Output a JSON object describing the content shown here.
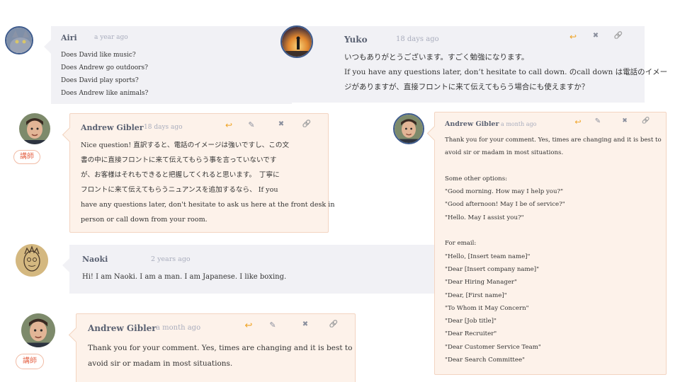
{
  "comments": {
    "airi": {
      "name": "Airi",
      "time": "a year ago",
      "lines": [
        "Does David like music?",
        "Does Andrew go outdoors?",
        "Does David play sports?",
        "Does Andrew like animals?"
      ]
    },
    "yuko": {
      "name": "Yuko",
      "time": "18 days ago",
      "lines": [
        "いつもありがとうございます。すごく勉強になります。",
        "If you have any questions later, don’t hesitate to call down. のcall down は電話のイメー",
        "ジがありますが、直接フロントに来て伝えてもらう場合にも使えますか？"
      ]
    },
    "andrew1": {
      "name": "Andrew Gibler",
      "time": "18 days ago",
      "badge": "講師",
      "lines": [
        "Nice question! 直訳すると、電話のイメージは強いですし、この文",
        "書の中に直接フロントに来て伝えてもらう事を言っていないです",
        "が、お客様はそれもできると把握してくれると思います。　丁寧に",
        "フロントに来て伝えてもらうニュアンスを追加するなら、 If you",
        "have any questions later, don't hesitate to ask us here at the front desk in",
        "person or call down from your room."
      ]
    },
    "andrew2": {
      "name": "Andrew Gibler",
      "time": "a month ago",
      "lines": [
        "Thank you for your comment. Yes, times are changing and it is best to",
        "avoid sir or madam in most situations.",
        "",
        "Some other options:",
        "\"Good morning. How may I help you?\"",
        "\"Good afternoon! May I be of service?\"",
        "\"Hello. May I assist you?\"",
        "",
        "For email:",
        "\"Hello, [Insert team name]\"",
        "\"Dear [Insert company name]\"",
        "\"Dear Hiring Manager\"",
        "\"Dear, [First name]\"",
        "\"To Whom it May Concern\"",
        "\"Dear [Job title]\"",
        "\"Dear Recruiter\"",
        "\"Dear Customer Service Team\"",
        "\"Dear Search Committee\""
      ]
    },
    "naoki": {
      "name": "Naoki",
      "time": "2 years ago",
      "lines": [
        "Hi! I am Naoki. I am a man. I am Japanese. I like boxing."
      ]
    },
    "andrew3": {
      "name": "Andrew Gibler",
      "time": "a month ago",
      "badge": "講師",
      "lines": [
        "Thank you for your comment. Yes, times are changing and it is best to",
        "avoid sir or madam in most situations."
      ]
    }
  },
  "actions": {
    "reply": "↩",
    "edit": "✎",
    "delete": "✖",
    "link": "🔗"
  },
  "icons": [
    "reply-icon",
    "edit-icon",
    "delete-icon",
    "link-icon",
    "avatar-cat",
    "avatar-silhouette",
    "avatar-andrew",
    "avatar-naoki-sketch"
  ],
  "colors": {
    "teacher_badge": "#e5674a",
    "reply": "#f0a322",
    "name": "#5a6172",
    "time": "#a9adbd"
  }
}
